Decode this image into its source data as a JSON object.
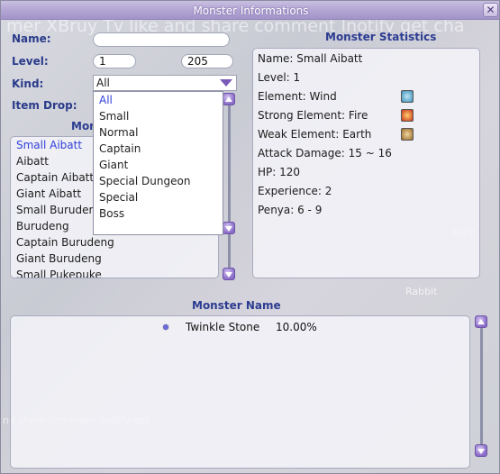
{
  "window": {
    "title": "Monster Informations"
  },
  "background_text": {
    "banner": "mer XBruy Tv like and share comment Inotify get cha",
    "bottom": "nd share comment Inotify get",
    "rabbit": "Rabbit",
    "elite": "ELITE"
  },
  "search": {
    "name_label": "Name:",
    "name_value": "",
    "level_label": "Level:",
    "level_min": "1",
    "level_max": "205",
    "kind_label": "Kind:",
    "kind_value": "All",
    "item_drop_label": "Item Drop:"
  },
  "kind_dropdown": {
    "options": [
      "All",
      "Small",
      "Normal",
      "Captain",
      "Giant",
      "Special Dungeon",
      "Special",
      "Boss"
    ],
    "selected": "All"
  },
  "monster_list": {
    "header": "Mon",
    "items": [
      "Small Aibatt",
      "Aibatt",
      "Captain Aibatt",
      "Giant Aibatt",
      "Small Burudeng",
      "Burudeng",
      "Captain Burudeng",
      "Giant Burudeng",
      "Small Pukepuke"
    ],
    "selected": "Small Aibatt"
  },
  "statistics": {
    "header": "Monster Statistics",
    "name": "Name: Small Aibatt",
    "level": "Level: 1",
    "element": "Element: Wind",
    "strong_element": "Strong Element: Fire",
    "weak_element": "Weak Element: Earth",
    "attack_damage": "Attack Damage: 15 ~ 16",
    "hp": "HP: 120",
    "experience": "Experience: 2",
    "penya": "Penya: 6 - 9",
    "icons": {
      "wind": "wind-element-icon",
      "fire": "fire-element-icon",
      "earth": "earth-element-icon"
    },
    "colors": {
      "wind": "#3a8fb8",
      "fire": "#c83218",
      "earth": "#9a6a2a"
    }
  },
  "drops": {
    "header": "Monster Name",
    "items": [
      {
        "name": "Twinkle Stone",
        "rate": "10.00%"
      }
    ]
  },
  "colors": {
    "label_blue": "#2a3b8a",
    "selected_text": "#3040d8",
    "titlebar": "#b3a6d4"
  }
}
